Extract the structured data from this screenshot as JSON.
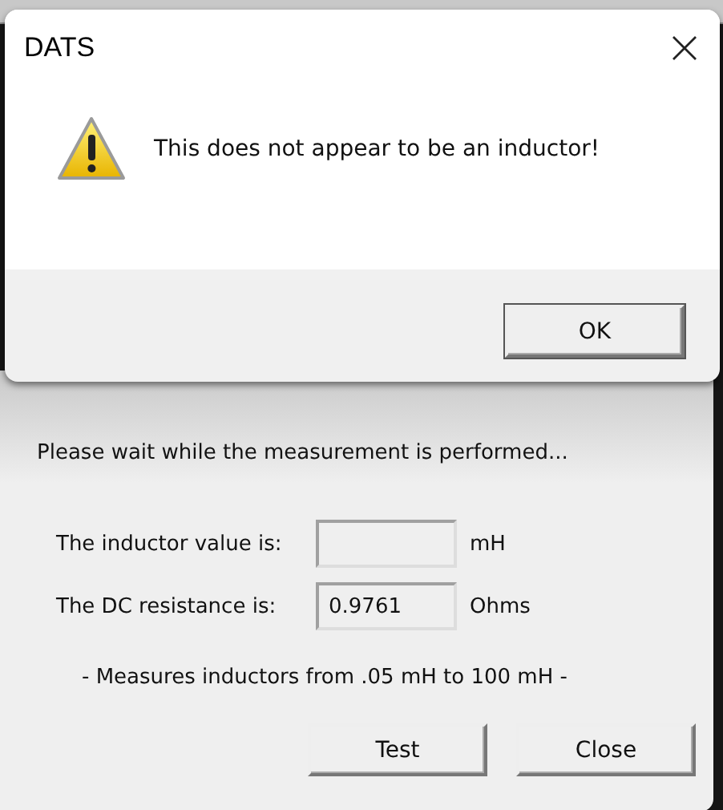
{
  "message_box": {
    "title": "DATS",
    "message": "This does not appear to be an inductor!",
    "buttons": [
      {
        "label": "OK"
      }
    ]
  },
  "dialog": {
    "status": "Please wait while the measurement is performed...",
    "fields": [
      {
        "label": "The inductor value is:",
        "unit": "mH"
      },
      {
        "label": "The DC resistance is:",
        "value": "0.9761",
        "unit": "Ohms"
      }
    ],
    "note": "- Measures inductors from .05 mH to 100 mH -",
    "buttons": [
      {
        "label": "Test"
      },
      {
        "label": "Close"
      }
    ]
  }
}
